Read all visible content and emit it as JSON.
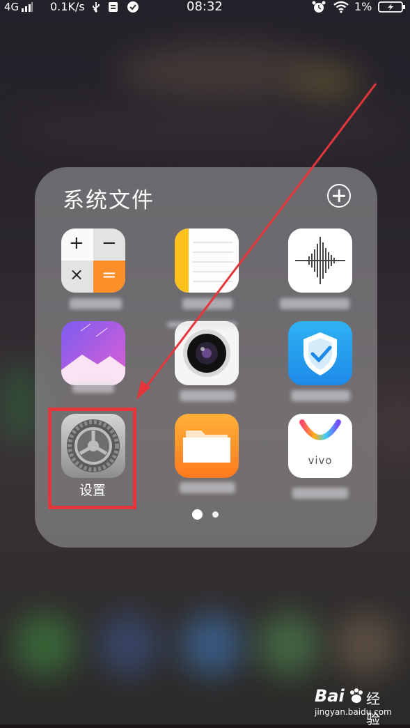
{
  "status_bar": {
    "network": "4G",
    "speed": "0.1K/s",
    "time": "08:32",
    "battery": "1%"
  },
  "folder": {
    "title": "系统文件",
    "page_indicator": {
      "pages": 2,
      "current": 1
    }
  },
  "apps": [
    {
      "icon": "calculator-icon",
      "label": ""
    },
    {
      "icon": "notes-icon",
      "label": ""
    },
    {
      "icon": "voice-memo-icon",
      "label": ""
    },
    {
      "icon": "gallery-icon",
      "label": ""
    },
    {
      "icon": "camera-icon",
      "label": ""
    },
    {
      "icon": "security-shield-icon",
      "label": ""
    },
    {
      "icon": "settings-gear-icon",
      "label": "设置"
    },
    {
      "icon": "files-folder-icon",
      "label": ""
    },
    {
      "icon": "vivo-app-store-icon",
      "label": ""
    }
  ],
  "calculator_keys": [
    "+",
    "−",
    "×",
    "="
  ],
  "vivo_logo_text": "vivo",
  "annotation": {
    "color": "#e6353a"
  },
  "watermark": {
    "brand": "Bai",
    "brand_cn": "经验",
    "url": "jingyan.baidu.com"
  }
}
